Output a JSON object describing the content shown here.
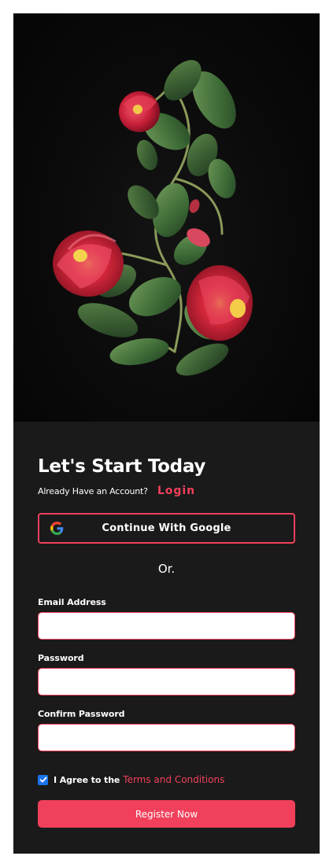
{
  "hero": {
    "image": "rose-bouquet-illustration"
  },
  "signup": {
    "title": "Let's Start Today",
    "have_account_text": "Already Have an Account?",
    "login_link": "Login",
    "google_button_label": "Continue With Google",
    "divider_text": "Or.",
    "email_label": "Email Address",
    "email_value": "",
    "password_label": "Password",
    "password_value": "",
    "confirm_password_label": "Confirm Password",
    "confirm_password_value": "",
    "agree_text": "I Agree to the",
    "terms_link": "Terms and Conditions",
    "agree_checked": true,
    "register_button_label": "Register Now"
  },
  "colors": {
    "accent": "#f1405b",
    "card_background": "#1a1a1a",
    "page_background": "#ffffff",
    "checkbox": "#1a73e8"
  },
  "icons": {
    "google": "google-g-icon",
    "checkbox": "checkmark-icon"
  }
}
